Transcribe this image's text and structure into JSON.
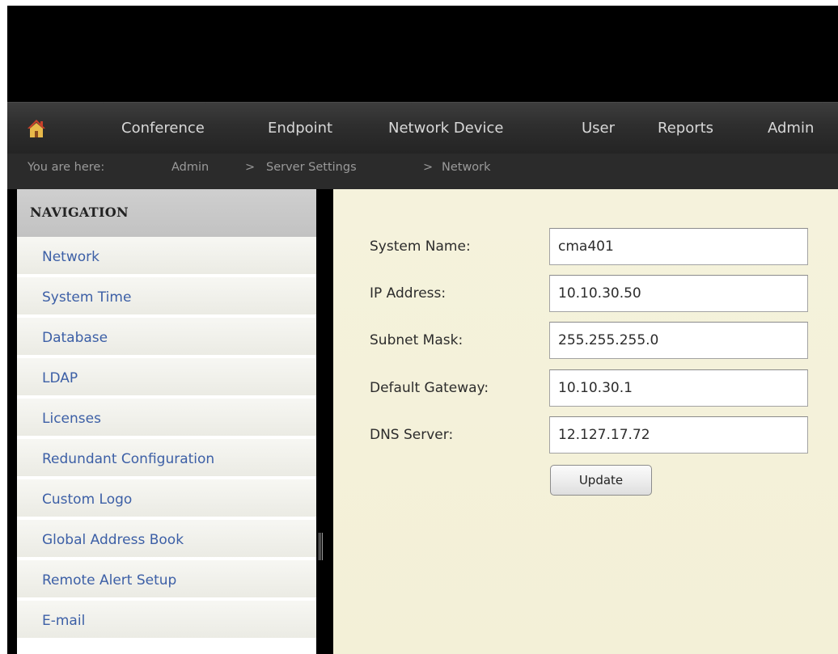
{
  "nav": {
    "home_icon": "home-icon",
    "items": [
      "Conference",
      "Endpoint",
      "Network Device",
      "User",
      "Reports",
      "Admin"
    ]
  },
  "breadcrumb": {
    "label": "You are here:",
    "items": [
      "Admin",
      "Server Settings",
      "Network"
    ],
    "separator": ">"
  },
  "sidebar": {
    "heading": "NAVIGATION",
    "items": [
      {
        "label": "Network"
      },
      {
        "label": "System Time"
      },
      {
        "label": "Database"
      },
      {
        "label": "LDAP"
      },
      {
        "label": "Licenses"
      },
      {
        "label": "Redundant Configuration"
      },
      {
        "label": "Custom Logo"
      },
      {
        "label": "Global Address Book"
      },
      {
        "label": "Remote Alert Setup"
      },
      {
        "label": "E-mail"
      }
    ]
  },
  "form": {
    "fields": [
      {
        "label": "System Name:",
        "value": "cma401"
      },
      {
        "label": "IP Address:",
        "value": "10.10.30.50"
      },
      {
        "label": "Subnet Mask:",
        "value": "255.255.255.0"
      },
      {
        "label": "Default Gateway:",
        "value": "10.10.30.1"
      },
      {
        "label": "DNS Server:",
        "value": "12.127.17.72"
      }
    ],
    "update_label": "Update"
  },
  "colors": {
    "topbar": "#000000",
    "navbar": "#2e2e2e",
    "nav_text": "#d8d8d8",
    "breadcrumb_text": "#9a9a9a",
    "sidebar_heading_bg": "#c8c8c8",
    "sidebar_link": "#3c5fa6",
    "content_bg": "#f4f1da",
    "home_icon": "#c8412a"
  }
}
